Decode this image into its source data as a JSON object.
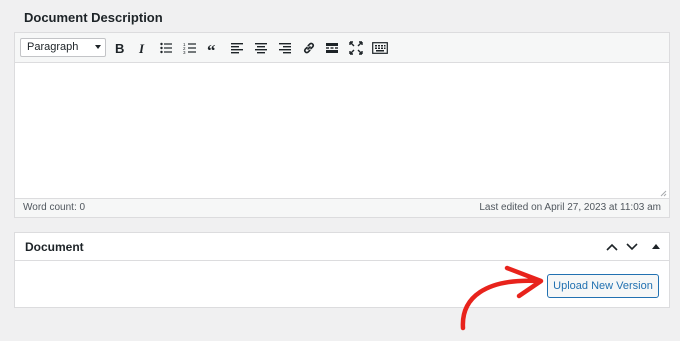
{
  "page": {
    "description_title": "Document Description",
    "document_title": "Document"
  },
  "editor": {
    "format_select": "Paragraph",
    "word_count": "Word count: 0",
    "last_edited": "Last edited on April 27, 2023 at 11:03 am",
    "toolbar_icons": [
      "bold-icon",
      "italic-icon",
      "bulleted-list-icon",
      "numbered-list-icon",
      "blockquote-icon",
      "align-left-icon",
      "align-center-icon",
      "align-right-icon",
      "link-icon",
      "read-more-icon",
      "fullscreen-icon",
      "toolbar-toggle-icon"
    ]
  },
  "document_box": {
    "upload_label": "Upload New Version",
    "header_icons": [
      "chevron-up-icon",
      "chevron-down-icon",
      "triangle-up-icon"
    ]
  },
  "colors": {
    "accent": "#2271b1",
    "annotation_arrow": "#e8231c",
    "background": "#f0f0f1"
  }
}
